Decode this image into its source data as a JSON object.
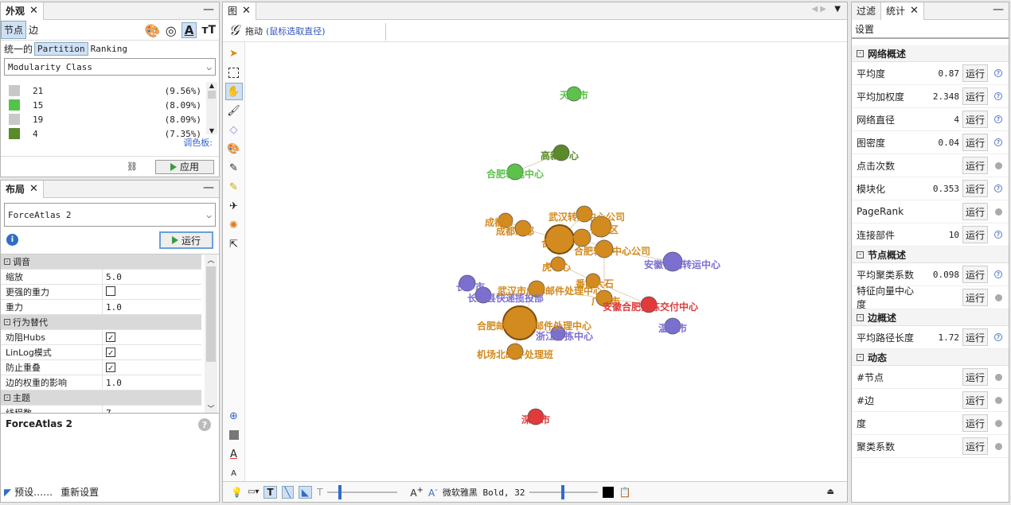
{
  "appearance_panel": {
    "tab_title": "外观",
    "subtabs": [
      "节点",
      "边"
    ],
    "mode_tabs": [
      "统一的",
      "Partition",
      "Ranking"
    ],
    "attribute": "Modularity Class",
    "partitions": [
      {
        "label": "21",
        "pct": "(9.56%)",
        "color": "#c8c8c8"
      },
      {
        "label": "15",
        "pct": "(8.09%)",
        "color": "#55c24a"
      },
      {
        "label": "19",
        "pct": "(8.09%)",
        "color": "#c8c8c8"
      },
      {
        "label": "4",
        "pct": "(7.35%)",
        "color": "#5a8a2a"
      }
    ],
    "palette_link": "调色板:",
    "apply_label": "应用"
  },
  "layout_panel": {
    "tab_title": "布局",
    "algorithm": "ForceAtlas 2",
    "run_label": "运行",
    "categories": [
      {
        "title": "调音",
        "rows": [
          {
            "k": "缩放",
            "v": "5.0",
            "type": "text"
          },
          {
            "k": "更强的重力",
            "v": "",
            "type": "check",
            "checked": false
          },
          {
            "k": "重力",
            "v": "1.0",
            "type": "text"
          }
        ]
      },
      {
        "title": "行为替代",
        "rows": [
          {
            "k": "劝阻Hubs",
            "v": "",
            "type": "check",
            "checked": true
          },
          {
            "k": "LinLog模式",
            "v": "",
            "type": "check",
            "checked": true
          },
          {
            "k": "防止重叠",
            "v": "",
            "type": "check",
            "checked": true
          },
          {
            "k": "边的权重的影响",
            "v": "1.0",
            "type": "text"
          }
        ]
      },
      {
        "title": "主题",
        "rows": [
          {
            "k": "线程数",
            "v": "7",
            "type": "text"
          }
        ]
      }
    ],
    "description_title": "ForceAtlas 2",
    "presets_label": "预设……",
    "reset_label": "重新设置"
  },
  "graph_panel": {
    "tab_title": "图",
    "mode_label": "拖动",
    "mode_hint": "(鼠标选取直径)",
    "font_label": "微软雅黑 Bold, 32",
    "nodes": [
      {
        "label": "天津市",
        "color": "#5cc24a",
        "label_color": "#5cc24a",
        "r": 9
      },
      {
        "label": "高新中心",
        "color": "#5a8a2a",
        "label_color": "#5a8a2a",
        "r": 10
      },
      {
        "label": "合肥转运中心",
        "color": "#5cc24a",
        "label_color": "#5cc24a",
        "r": 10
      },
      {
        "label": "武汉转运中心公司",
        "color": "#d38a1e",
        "label_color": "#d38a1e",
        "r": 10
      },
      {
        "label": "成都市",
        "color": "#d38a1e",
        "label_color": "#d38a1e",
        "r": 9
      },
      {
        "label": "成都二部",
        "color": "#d38a1e",
        "label_color": "#d38a1e",
        "r": 10
      },
      {
        "label": "合肥",
        "color": "#d38a1e",
        "label_color": "#d38a1e",
        "r": 18
      },
      {
        "label": "合肥区",
        "color": "#d38a1e",
        "label_color": "#d38a1e",
        "r": 13
      },
      {
        "label": "二部",
        "color": "#d38a1e",
        "label_color": "#d38a1e",
        "r": 11
      },
      {
        "label": "合肥转运中心公司",
        "color": "#d38a1e",
        "label_color": "#d38a1e",
        "r": 11
      },
      {
        "label": "安徽合肥转运中心",
        "color": "#7b6fd0",
        "label_color": "#7b6fd0",
        "r": 12
      },
      {
        "label": "虎中心",
        "color": "#d38a1e",
        "label_color": "#d38a1e",
        "r": 9
      },
      {
        "label": "番禺大石",
        "color": "#d38a1e",
        "label_color": "#d38a1e",
        "r": 9
      },
      {
        "label": "长沙市",
        "color": "#7b6fd0",
        "label_color": "#7b6fd0",
        "r": 10
      },
      {
        "label": "长沙县快递揽投部",
        "color": "#7b6fd0",
        "label_color": "#7b6fd0",
        "r": 10
      },
      {
        "label": "武汉市成都邮件处理中心",
        "color": "#d38a1e",
        "label_color": "#d38a1e",
        "r": 10
      },
      {
        "label": "广州市",
        "color": "#d38a1e",
        "label_color": "#d38a1e",
        "r": 10
      },
      {
        "label": "安徽合肥分拣交付中心",
        "color": "#e03a3a",
        "label_color": "#e03a3a",
        "r": 10
      },
      {
        "label": "合肥邮区中心邮件处理中心",
        "color": "#d38a1e",
        "label_color": "#d38a1e",
        "r": 21
      },
      {
        "label": "浙江分拣中心",
        "color": "#7b6fd0",
        "label_color": "#7b6fd0",
        "r": 9
      },
      {
        "label": "温州市",
        "color": "#7b6fd0",
        "label_color": "#7b6fd0",
        "r": 10
      },
      {
        "label": "机场北邮件处理班",
        "color": "#d38a1e",
        "label_color": "#d38a1e",
        "r": 10
      },
      {
        "label": "深圳市",
        "color": "#e03a3a",
        "label_color": "#e03a3a",
        "r": 10
      }
    ]
  },
  "stats_panel": {
    "tabs": [
      "过滤",
      "统计"
    ],
    "settings_label": "设置",
    "run_label": "运行",
    "sections": [
      {
        "title": "网络概述",
        "rows": [
          {
            "label": "平均度",
            "value": "0.87",
            "info": "q"
          },
          {
            "label": "平均加权度",
            "value": "2.348",
            "info": "q"
          },
          {
            "label": "网络直径",
            "value": "4",
            "info": "q"
          },
          {
            "label": "图密度",
            "value": "0.04",
            "info": "q"
          },
          {
            "label": "点击次数",
            "value": "",
            "info": "g"
          },
          {
            "label": "模块化",
            "value": "0.353",
            "info": "q"
          },
          {
            "label": "PageRank",
            "value": "",
            "info": "g"
          },
          {
            "label": "连接部件",
            "value": "10",
            "info": "q"
          }
        ]
      },
      {
        "title": "节点概述",
        "rows": [
          {
            "label": "平均聚类系数",
            "value": "0.098",
            "info": "q"
          },
          {
            "label": "特征向量中心度",
            "value": "",
            "info": "g"
          }
        ]
      },
      {
        "title": "边概述",
        "rows": [
          {
            "label": "平均路径长度",
            "value": "1.72",
            "info": "q"
          }
        ]
      },
      {
        "title": "动态",
        "rows": [
          {
            "label": "#节点",
            "value": "",
            "info": "g"
          },
          {
            "label": "#边",
            "value": "",
            "info": "g"
          },
          {
            "label": "度",
            "value": "",
            "info": "g"
          },
          {
            "label": "聚类系数",
            "value": "",
            "info": "g"
          }
        ]
      }
    ]
  }
}
